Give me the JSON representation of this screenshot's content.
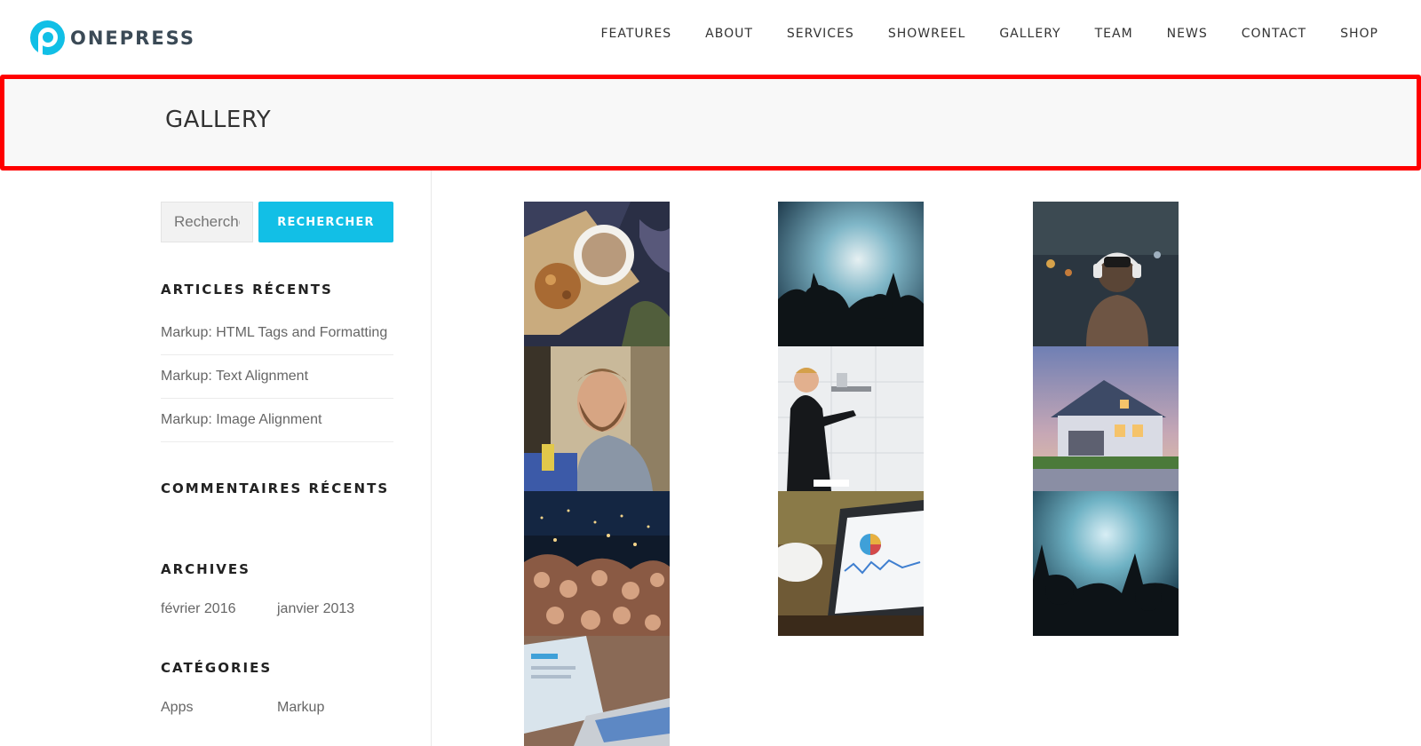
{
  "brand": {
    "name": "ONEPRESS"
  },
  "nav": {
    "items": [
      "FEATURES",
      "ABOUT",
      "SERVICES",
      "SHOWREEL",
      "GALLERY",
      "TEAM",
      "NEWS",
      "CONTACT",
      "SHOP"
    ]
  },
  "page": {
    "title": "GALLERY"
  },
  "sidebar": {
    "search": {
      "placeholder": "Rechercher",
      "button": "RECHERCHER"
    },
    "recent_posts": {
      "title": "ARTICLES RÉCENTS",
      "items": [
        "Markup: HTML Tags and Formatting",
        "Markup: Text Alignment",
        "Markup: Image Alignment"
      ]
    },
    "recent_comments": {
      "title": "COMMENTAIRES RÉCENTS"
    },
    "archives": {
      "title": "ARCHIVES",
      "items": [
        "février 2016",
        "janvier 2013"
      ]
    },
    "categories": {
      "title": "CATÉGORIES",
      "items": [
        "Apps",
        "Markup"
      ]
    }
  },
  "gallery": {
    "images": [
      {
        "name": "coffee-cup-photo"
      },
      {
        "name": "concert-crowd-photo"
      },
      {
        "name": "headphones-man-photo"
      },
      {
        "name": "bearded-man-photo"
      },
      {
        "name": "man-at-whiteboard-photo"
      },
      {
        "name": "house-at-dusk-photo"
      },
      {
        "name": "night-crowd-photo"
      },
      {
        "name": "tablet-analytics-photo"
      },
      {
        "name": "concert-crowd-photo"
      },
      {
        "name": "laptop-screen-photo"
      }
    ]
  },
  "colors": {
    "accent": "#12bfe6",
    "highlight_border": "#ff0000",
    "title_band": "#f8f8f8"
  }
}
